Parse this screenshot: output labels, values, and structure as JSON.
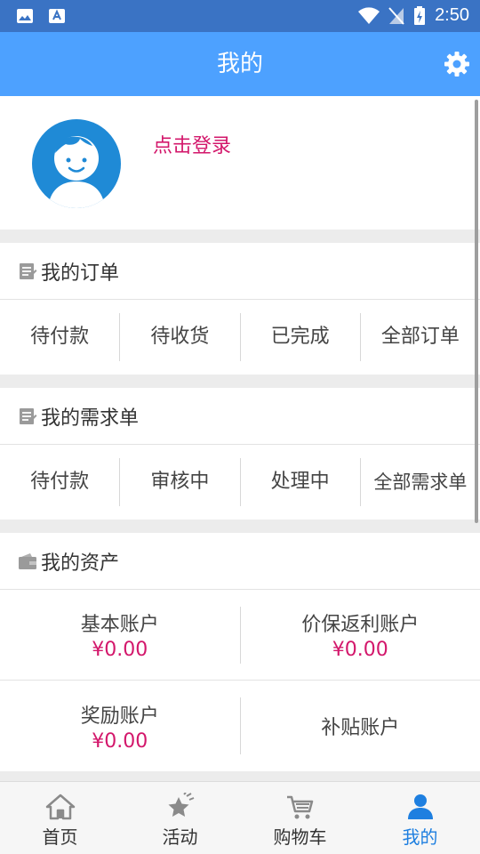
{
  "status_bar": {
    "time": "2:50"
  },
  "header": {
    "title": "我的"
  },
  "profile": {
    "login_link": "点击登录"
  },
  "orders": {
    "title": "我的订单",
    "items": [
      {
        "label": "待付款"
      },
      {
        "label": "待收货"
      },
      {
        "label": "已完成"
      },
      {
        "label": "全部订单"
      }
    ]
  },
  "requests": {
    "title": "我的需求单",
    "items": [
      {
        "label": "待付款"
      },
      {
        "label": "审核中"
      },
      {
        "label": "处理中"
      },
      {
        "label": "全部需求单"
      }
    ]
  },
  "assets": {
    "title": "我的资产",
    "items": [
      {
        "label": "基本账户",
        "amount": "¥0.00"
      },
      {
        "label": "价保返利账户",
        "amount": "¥0.00"
      },
      {
        "label": "奖励账户",
        "amount": "¥0.00"
      },
      {
        "label": "补贴账户"
      }
    ]
  },
  "tabbar": {
    "items": [
      {
        "label": "首页",
        "icon": "home-icon"
      },
      {
        "label": "活动",
        "icon": "star-icon"
      },
      {
        "label": "购物车",
        "icon": "cart-icon"
      },
      {
        "label": "我的",
        "icon": "person-icon",
        "active": true
      }
    ]
  },
  "colors": {
    "appbar": "#4da1ff",
    "status_bar": "#3a73c4",
    "accent_pink": "#d3176b",
    "tab_active": "#1e7fe0"
  }
}
